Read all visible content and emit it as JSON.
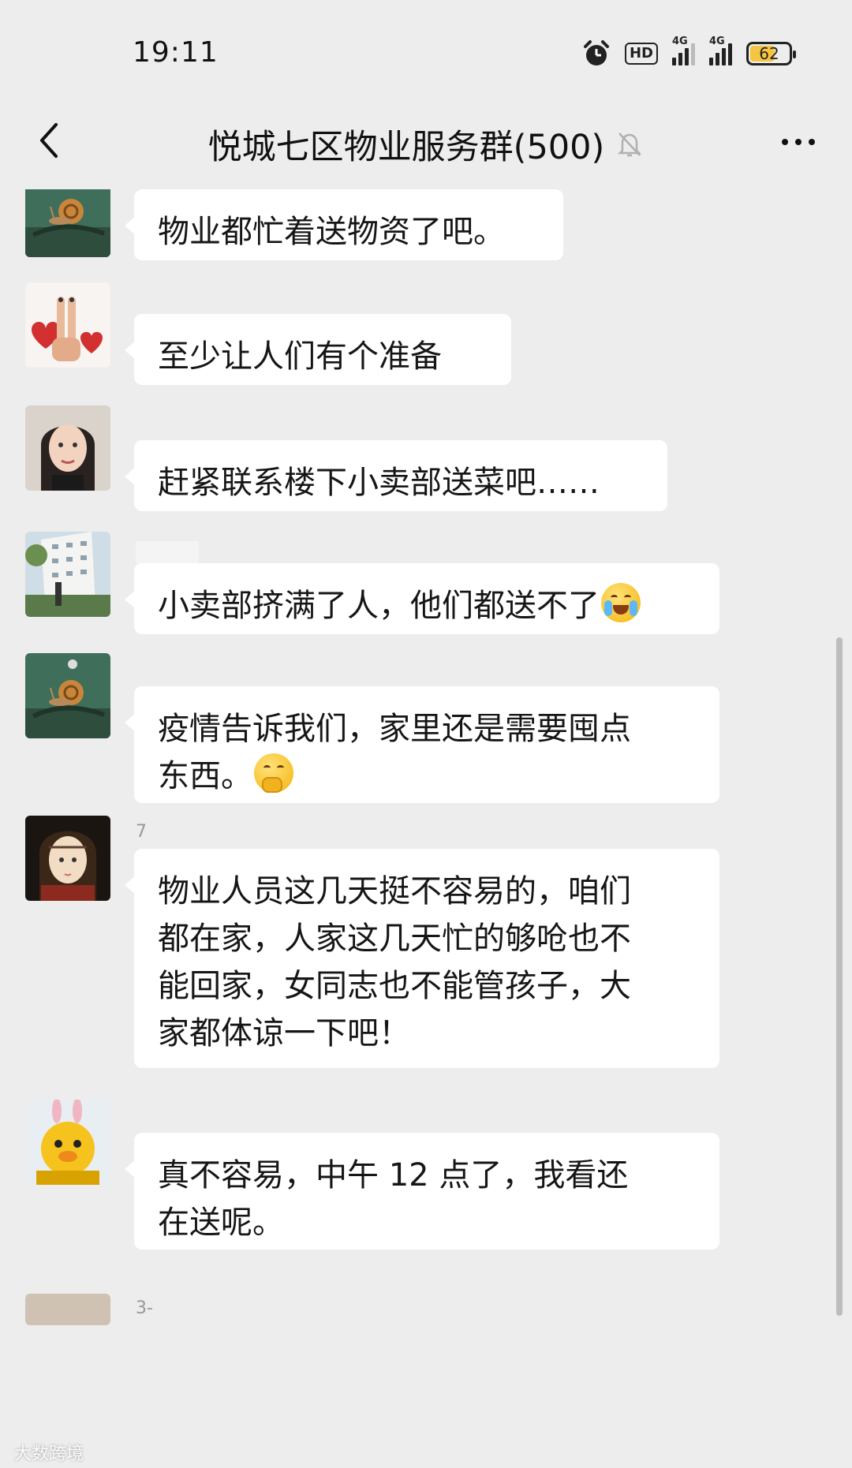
{
  "status_bar": {
    "time": "19:11",
    "icons": [
      "alarm-icon",
      "hd-voice-icon",
      "signal-4g-icon",
      "signal-4g-icon",
      "battery-icon"
    ],
    "hd_label": "HD",
    "network_1": "4G",
    "network_2": "4G",
    "battery_level": "62"
  },
  "nav": {
    "title": "悦城七区物业服务群(500)",
    "back_icon": "chevron-left-icon",
    "mute_icon": "bell-muted-icon",
    "more_icon": "more-dots-icon"
  },
  "messages": [
    {
      "avatar": "snail-avatar",
      "text": "物业都忙着送物资了吧。"
    },
    {
      "avatar": "hands-heart-avatar",
      "text": "至少让人们有个准备"
    },
    {
      "avatar": "woman-portrait-avatar",
      "text": "赶紧联系楼下小卖部送菜吧……"
    },
    {
      "avatar": "building-photo-avatar",
      "text": "小卖部挤满了人，他们都送不了",
      "emoji": "crying-face-emoji"
    },
    {
      "avatar": "snail-avatar",
      "text_lines": [
        "疫情告诉我们，家里还是需要囤点",
        "东西。"
      ],
      "emoji": "hand-over-mouth-emoji"
    },
    {
      "avatar": "painting-girl-avatar",
      "nick": "7",
      "text_lines": [
        "物业人员这几天挺不容易的，咱们",
        "都在家，人家这几天忙的够呛也不",
        "能回家，女同志也不能管孩子，大",
        "家都体谅一下吧！"
      ]
    },
    {
      "avatar": "yellow-chick-avatar",
      "text_lines": [
        "真不容易，中午 12 点了，我看还",
        "在送呢。"
      ]
    },
    {
      "nick": "3-"
    }
  ],
  "watermark": "大数跨境",
  "colors": {
    "background": "#ededed",
    "bubble": "#ffffff",
    "text": "#161616"
  }
}
